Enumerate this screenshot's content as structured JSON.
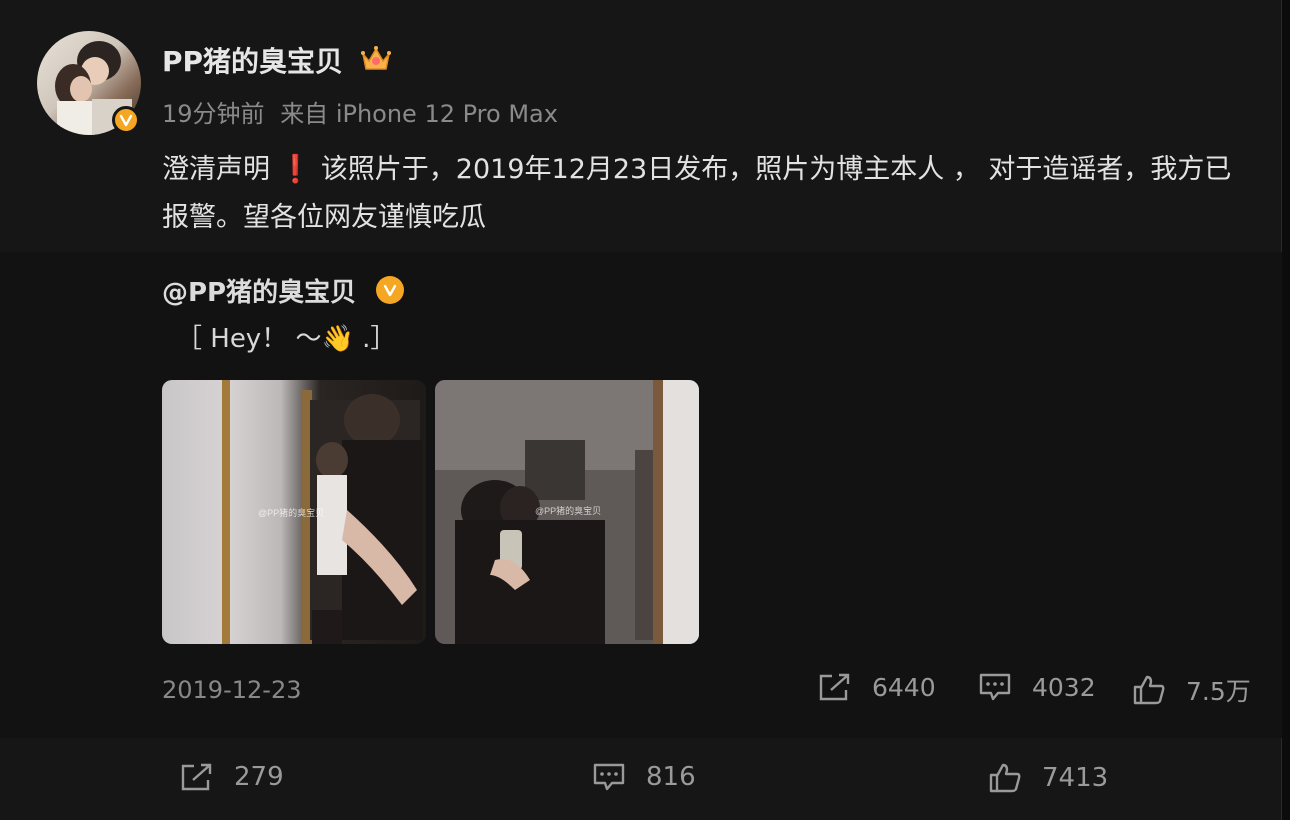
{
  "author": {
    "name": "PP猪的臭宝贝",
    "time": "19分钟前",
    "source": "来自 iPhone 12 Pro Max",
    "badge_color": "#f5a623"
  },
  "post": {
    "text_a": "澄清声明",
    "exclaim": "❗",
    "text_b": "该照片于，2019年12月23日发布，照片为博主本人 ， 对于造谣者，我方已报警。望各位网友谨慎吃瓜"
  },
  "repost": {
    "user": "@PP猪的臭宝贝",
    "text": "［ Hey！ ～👋 .］",
    "date": "2019-12-23",
    "watermark": "@PP猪的臭宝贝",
    "stats": {
      "share": "6440",
      "comment": "4032",
      "like": "7.5万"
    }
  },
  "footer": {
    "share": "279",
    "comment": "816",
    "like": "7413"
  },
  "colors": {
    "background": "#161616",
    "accent_badge": "#f5a623",
    "exclaim": "#e0242d"
  }
}
